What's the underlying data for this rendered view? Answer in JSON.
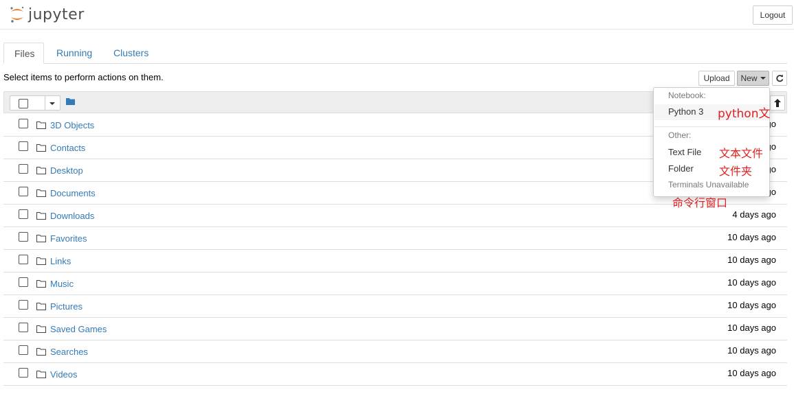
{
  "header": {
    "logo_text": "jupyter",
    "logout_label": "Logout"
  },
  "tabs": [
    {
      "label": "Files",
      "active": true
    },
    {
      "label": "Running",
      "active": false
    },
    {
      "label": "Clusters",
      "active": false
    }
  ],
  "toolbar": {
    "hint": "Select items to perform action​s on them.",
    "upload_label": "Upload",
    "new_label": "New",
    "refresh_icon": "refresh-icon"
  },
  "files": [
    {
      "name": "3D Objects",
      "modified": "10 days ago"
    },
    {
      "name": "Contacts",
      "modified": "10 days ago"
    },
    {
      "name": "Desktop",
      "modified": "10 days ago"
    },
    {
      "name": "Documents",
      "modified": "10 days ago"
    },
    {
      "name": "Downloads",
      "modified": "4 days ago"
    },
    {
      "name": "Favorites",
      "modified": "10 days ago"
    },
    {
      "name": "Links",
      "modified": "10 days ago"
    },
    {
      "name": "Music",
      "modified": "10 days ago"
    },
    {
      "name": "Pictures",
      "modified": "10 days ago"
    },
    {
      "name": "Saved Games",
      "modified": "10 days ago"
    },
    {
      "name": "Searches",
      "modified": "10 days ago"
    },
    {
      "name": "Videos",
      "modified": "10 days ago"
    }
  ],
  "new_menu": {
    "notebook_header": "Notebook:",
    "python3": "Python 3",
    "other_header": "Other:",
    "text_file": "Text File",
    "folder": "Folder",
    "terminals": "Terminals Unavailable"
  },
  "annotations": {
    "python": "python文",
    "text_file": "文本文件",
    "folder": "文件夹",
    "terminal": "命令行窗口"
  },
  "colors": {
    "link": "#337ab7",
    "annotation": "#e02020",
    "logo_orange": "#f37726"
  }
}
